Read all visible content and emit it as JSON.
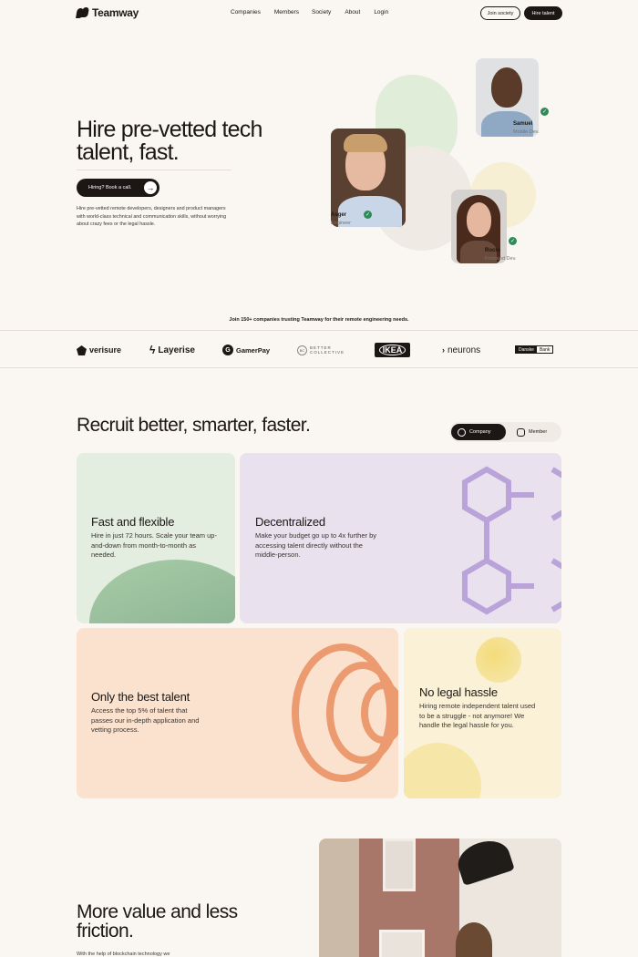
{
  "nav": {
    "logo": "Teamway",
    "links": [
      "Companies",
      "Members",
      "Society",
      "About",
      "Login"
    ],
    "join_label": "Join society",
    "hire_label": "Hire talent"
  },
  "hero": {
    "title": "Hire pre-vetted tech talent, fast.",
    "cta": "Hiring? Book a call.",
    "description": "Hire pre-vetted remote developers, designers and product managers with world-class technical and communication skills, without worrying about crazy fees or the legal hassle."
  },
  "people": [
    {
      "name": "Samuel",
      "role": "Mobile Dev."
    },
    {
      "name": "Asger",
      "role": "Engineer"
    },
    {
      "name": "Rocio",
      "role": "Frontend Dev."
    }
  ],
  "trust": {
    "text": "Join 150+ companies trusting Teamway for their remote engineering needs.",
    "brands": [
      "verisure",
      "Layerise",
      "GamerPay",
      "BETTER COLLECTIVE",
      "IKEA",
      "neurons",
      "Danske",
      "Bank"
    ]
  },
  "features": {
    "title": "Recruit better, smarter, faster.",
    "toggle": {
      "company": "Company",
      "member": "Member"
    },
    "cards": [
      {
        "title": "Fast and flexible",
        "desc": "Hire in just 72 hours. Scale your team up-and-down from month-to-month as needed."
      },
      {
        "title": "Decentralized",
        "desc": "Make your budget go up to 4x further by accessing talent directly without the middle-person."
      },
      {
        "title": "Only the best talent",
        "desc": "Access the top 5% of talent that passes our in-depth application and vetting process."
      },
      {
        "title": "No legal hassle",
        "desc": "Hiring remote independent talent used to be a struggle - not anymore! We handle the legal hassle for you."
      }
    ]
  },
  "value": {
    "title": "More value and less friction.",
    "desc": "With the help of blockchain technology we"
  },
  "colors": {
    "dark": "#1c1714",
    "bg": "#faf7f3",
    "green_card": "#e3ede0",
    "purple_card": "#e9e1ee",
    "peach_card": "#fbe2cf",
    "yellow_card": "#fbf1d6",
    "check": "#2f8a5a"
  },
  "icons": [
    "arrow-right-icon",
    "globe-icon",
    "user-icon",
    "check-icon"
  ]
}
